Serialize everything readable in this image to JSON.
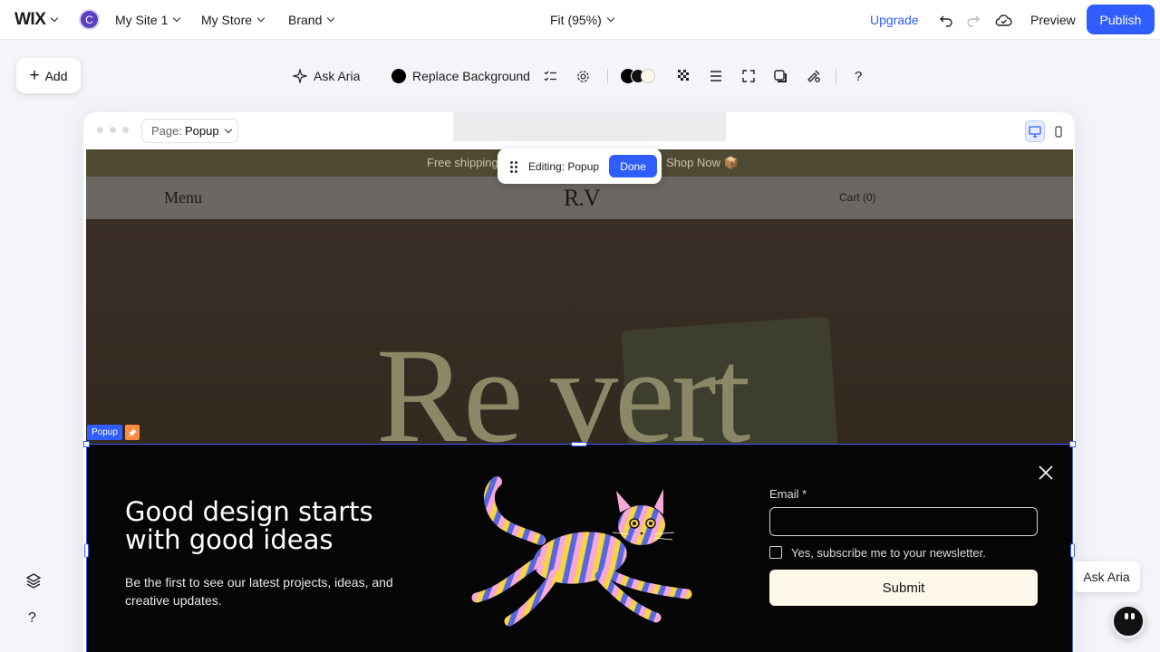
{
  "topbar": {
    "logo": "WIX",
    "avatar_initial": "C",
    "site_menu": "My Site 1",
    "store_menu": "My Store",
    "brand_menu": "Brand",
    "zoom": "Fit (95%)",
    "upgrade": "Upgrade",
    "preview": "Preview",
    "publish": "Publish"
  },
  "add_panel": {
    "label": "Add"
  },
  "toolbar": {
    "ask_aria": "Ask Aria",
    "replace_background": "Replace Background"
  },
  "canvas": {
    "page_label": "Page:",
    "page_value": "Popup"
  },
  "editing_badge": {
    "label": "Editing: Popup",
    "done": "Done"
  },
  "site": {
    "announcement_left": "Free shipping",
    "announcement_right": "Shop Now 📦",
    "menu": "Menu",
    "logo": "R.V",
    "cart": "Cart (0)",
    "hero_text": "Re vert"
  },
  "popup": {
    "tag": "Popup",
    "title": "Good design starts with good ideas",
    "subtitle": "Be the first to see our latest projects, ideas, and creative updates.",
    "email_label": "Email *",
    "checkbox_label": "Yes, subscribe me to your newsletter.",
    "submit": "Submit"
  },
  "aria_assistant": {
    "label": "Ask Aria"
  },
  "colors": {
    "accent": "#2f5dff",
    "popup_bg": "#050505",
    "submit_bg": "#fdf8ea"
  }
}
